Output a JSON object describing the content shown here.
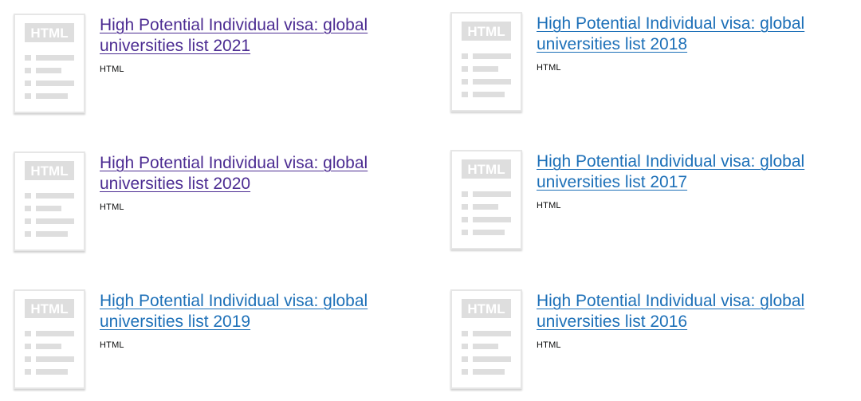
{
  "attachments": [
    {
      "title": "High Potential Individual visa: global universities list 2021",
      "format": "HTML",
      "visited": true,
      "thumb_label": "HTML"
    },
    {
      "title": "High Potential Individual visa: global universities list 2018",
      "format": "HTML",
      "visited": false,
      "thumb_label": "HTML"
    },
    {
      "title": "High Potential Individual visa: global universities list 2020",
      "format": "HTML",
      "visited": true,
      "thumb_label": "HTML"
    },
    {
      "title": "High Potential Individual visa: global universities list 2017",
      "format": "HTML",
      "visited": false,
      "thumb_label": "HTML"
    },
    {
      "title": "High Potential Individual visa: global universities list 2019",
      "format": "HTML",
      "visited": false,
      "thumb_label": "HTML"
    },
    {
      "title": "High Potential Individual visa: global universities list 2016",
      "format": "HTML",
      "visited": false,
      "thumb_label": "HTML"
    }
  ],
  "colors": {
    "link": "#1d70b8",
    "link_visited": "#4c2c92",
    "thumb_grey": "#dedede"
  },
  "icons": {
    "thumbnail": "html-document-icon"
  }
}
